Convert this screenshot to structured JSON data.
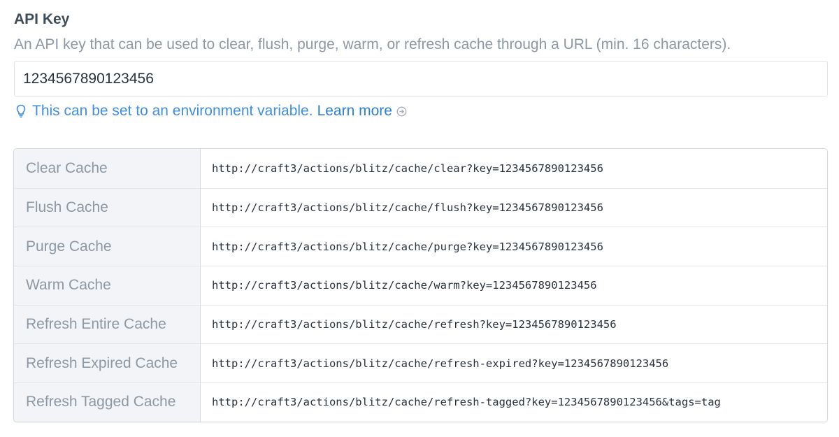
{
  "field": {
    "heading": "API Key",
    "instructions": "An API key that can be used to clear, flush, purge, warm, or refresh cache through a URL (min. 16 characters).",
    "value": "1234567890123456",
    "tip_text": "This can be set to an environment variable.",
    "learn_more": "Learn more",
    "tip_icon": "lightbulb-icon",
    "learn_more_icon": "arrow-circle-right-icon"
  },
  "colors": {
    "link": "#2d7fd8",
    "muted_text": "#8d98a3",
    "label_bg": "#f2f4f7"
  },
  "table": {
    "rows": [
      {
        "label": "Clear Cache",
        "url": "http://craft3/actions/blitz/cache/clear?key=1234567890123456"
      },
      {
        "label": "Flush Cache",
        "url": "http://craft3/actions/blitz/cache/flush?key=1234567890123456"
      },
      {
        "label": "Purge Cache",
        "url": "http://craft3/actions/blitz/cache/purge?key=1234567890123456"
      },
      {
        "label": "Warm Cache",
        "url": "http://craft3/actions/blitz/cache/warm?key=1234567890123456"
      },
      {
        "label": "Refresh Entire Cache",
        "url": "http://craft3/actions/blitz/cache/refresh?key=1234567890123456"
      },
      {
        "label": "Refresh Expired Cache",
        "url": "http://craft3/actions/blitz/cache/refresh-expired?key=1234567890123456"
      },
      {
        "label": "Refresh Tagged Cache",
        "url": "http://craft3/actions/blitz/cache/refresh-tagged?key=1234567890123456&tags=tag"
      }
    ]
  }
}
